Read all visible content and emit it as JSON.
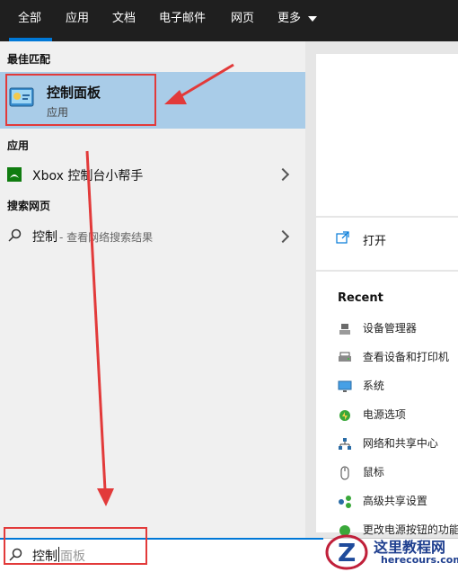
{
  "tabs": [
    {
      "label": "全部",
      "active": true
    },
    {
      "label": "应用"
    },
    {
      "label": "文档"
    },
    {
      "label": "电子邮件"
    },
    {
      "label": "网页"
    },
    {
      "label": "更多"
    }
  ],
  "sections": {
    "best_match": "最佳匹配",
    "apps": "应用",
    "web": "搜索网页"
  },
  "best_match": {
    "title": "控制面板",
    "subtitle": "应用"
  },
  "app_item": {
    "label": "Xbox 控制台小帮手"
  },
  "web_item": {
    "query": "控制",
    "hint": " - 查看网络搜索结果"
  },
  "actions": {
    "open": "打开"
  },
  "recent": {
    "heading": "Recent",
    "items": [
      {
        "label": "设备管理器",
        "icon": "device-manager-icon"
      },
      {
        "label": "查看设备和打印机",
        "icon": "printer-icon"
      },
      {
        "label": "系统",
        "icon": "monitor-icon"
      },
      {
        "label": "电源选项",
        "icon": "power-options-icon"
      },
      {
        "label": "网络和共享中心",
        "icon": "network-icon"
      },
      {
        "label": "鼠标",
        "icon": "mouse-icon"
      },
      {
        "label": "高级共享设置",
        "icon": "sharing-icon"
      },
      {
        "label": "更改电源按钮的功能",
        "icon": "power-icon"
      }
    ]
  },
  "search": {
    "typed": "控制",
    "suggestion": "面板"
  },
  "watermark": {
    "name": "这里教程网",
    "url": "herecours.com",
    "letter": "Z"
  },
  "colors": {
    "accent": "#0078d7",
    "highlight": "#a9cce8",
    "annotation_red": "#e23a3a"
  }
}
